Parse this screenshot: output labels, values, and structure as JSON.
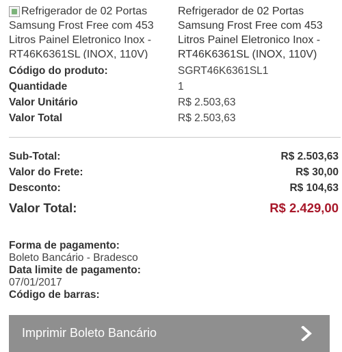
{
  "product": {
    "image_alt": "Refrigerador de 02 Portas Samsung Frost Free com 453 Litros Painel Eletronico Inox - RT46K6361SL (INOX, 110V)",
    "name": "Refrigerador de 02 Portas Samsung Frost Free com 453 Litros Painel Eletronico Inox - RT46K6361SL (INOX, 110V)"
  },
  "details": [
    {
      "label": "Código do produto:",
      "value": "SGRT46K6361SL1"
    },
    {
      "label": "Quantidade",
      "value": "1"
    },
    {
      "label": "Valor Unitário",
      "value": "R$ 2.503,63"
    },
    {
      "label": "Valor Total",
      "value": "R$ 2.503,63"
    }
  ],
  "totals": {
    "subtotal_label": "Sub-Total:",
    "subtotal_value": "R$ 2.503,63",
    "frete_label": "Valor do Frete:",
    "frete_value": "R$ 30,00",
    "desconto_label": "Desconto:",
    "desconto_value": "R$ 104,63",
    "grand_label": "Valor Total:",
    "grand_value": "R$ 2.429,00",
    "grand_color": "#a8182a"
  },
  "payment": {
    "method_label": "Forma de pagamento:",
    "method_value": "Boleto Bancário - Bradesco",
    "due_label": "Data limite de pagamento:",
    "due_value": "07/01/2017",
    "barcode_label": "Código de barras:"
  },
  "button": {
    "label": "Imprimir Boleto Bancário",
    "icon": "chevron-right-icon",
    "color": "#8f8f8f"
  }
}
